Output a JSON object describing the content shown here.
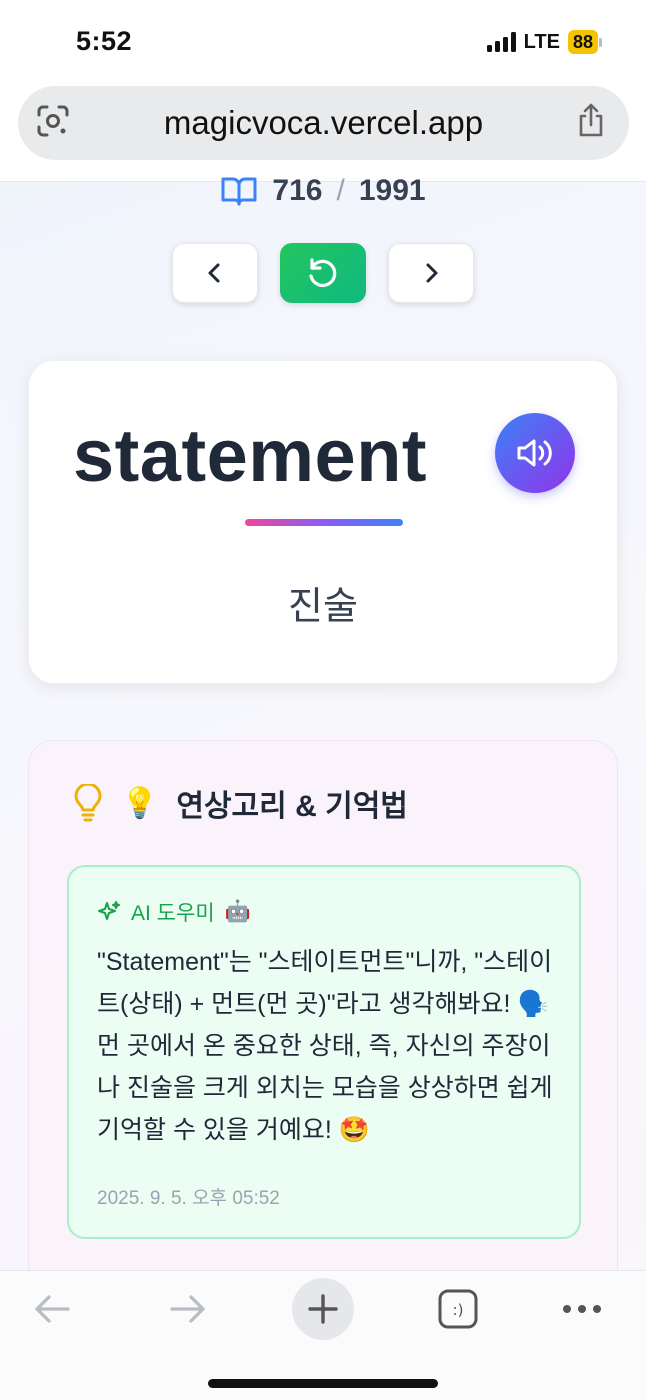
{
  "status_bar": {
    "time": "5:52",
    "network": "LTE",
    "battery": "88"
  },
  "browser": {
    "url": "magicvoca.vercel.app",
    "icons": {
      "left": "lens-icon",
      "right": "share-icon"
    }
  },
  "progress": {
    "current": "716",
    "separator": "/",
    "total": "1991"
  },
  "nav": {
    "prev_icon": "chevron-left-icon",
    "reset_icon": "refresh-icon",
    "next_icon": "chevron-right-icon"
  },
  "card": {
    "word": "statement",
    "meaning": "진술",
    "speaker_icon": "speaker-icon"
  },
  "mnemonic": {
    "emoji": "💡",
    "title": "연상고리 & 기억법",
    "ai_label": "AI 도우미",
    "ai_emoji": "🤖",
    "text": "\"Statement\"는 \"스테이트먼트\"니까, \"스테이트(상태) + 먼트(먼 곳)\"라고 생각해봐요! 🗣️ 먼 곳에서 온 중요한 상태, 즉, 자신의 주장이나 진술을 크게 외치는 모습을 상상하면 쉽게 기억할 수 있을 거예요! 🤩",
    "timestamp": "2025. 9. 5. 오후 05:52"
  },
  "toolbar": {
    "items": [
      "back-icon",
      "forward-icon",
      "plus-icon",
      "tabs-icon",
      "more-icon"
    ],
    "tabs_label": ":)"
  },
  "colors": {
    "accent_green": "#10b981",
    "accent_purple": "#9333ea",
    "accent_blue": "#3b82f6"
  }
}
